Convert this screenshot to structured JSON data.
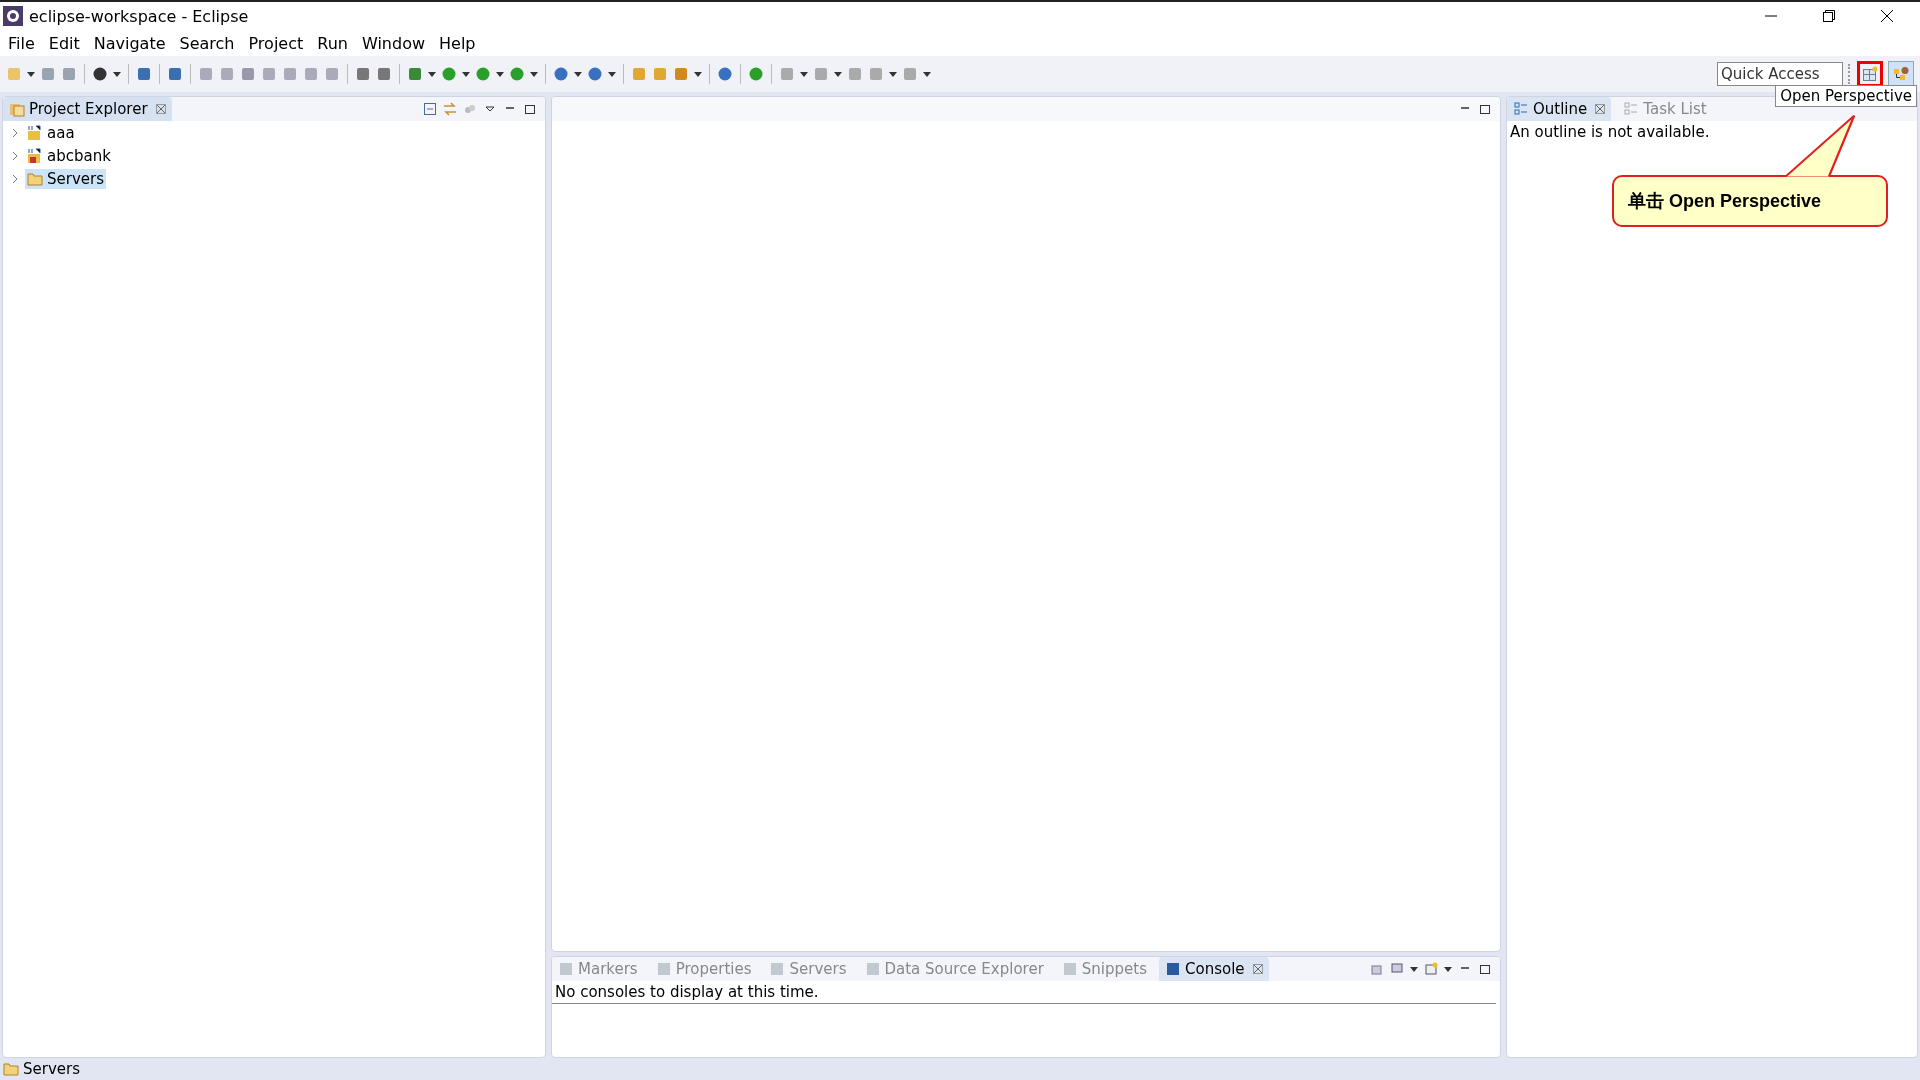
{
  "window": {
    "title": "eclipse-workspace - Eclipse"
  },
  "menu": [
    "File",
    "Edit",
    "Navigate",
    "Search",
    "Project",
    "Run",
    "Window",
    "Help"
  ],
  "quick_access": {
    "placeholder": "Quick Access"
  },
  "tooltip": "Open Perspective",
  "project_explorer": {
    "title": "Project Explorer",
    "items": [
      {
        "label": "aaa",
        "kind": "project",
        "selected": false
      },
      {
        "label": "abcbank",
        "kind": "project-error",
        "selected": false
      },
      {
        "label": "Servers",
        "kind": "folder",
        "selected": true
      }
    ]
  },
  "outline_tabs": [
    {
      "label": "Outline",
      "selected": true
    },
    {
      "label": "Task List",
      "selected": false
    }
  ],
  "outline_message": "An outline is not available.",
  "bottom_tabs": [
    {
      "label": "Markers",
      "selected": false
    },
    {
      "label": "Properties",
      "selected": false
    },
    {
      "label": "Servers",
      "selected": false
    },
    {
      "label": "Data Source Explorer",
      "selected": false
    },
    {
      "label": "Snippets",
      "selected": false
    },
    {
      "label": "Console",
      "selected": true
    }
  ],
  "console_message": "No consoles to display at this time.",
  "status_bar": "Servers",
  "callout": "单击 Open Perspective"
}
